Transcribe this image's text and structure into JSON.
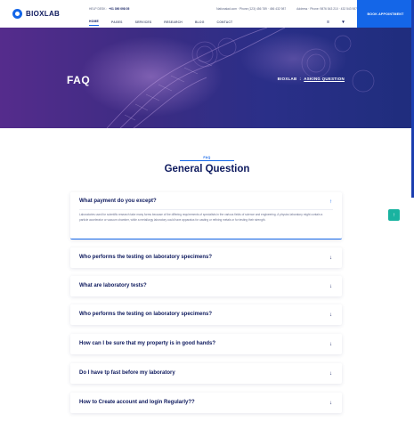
{
  "logo": {
    "text": "BIOXLAB"
  },
  "topbar": {
    "help_label": "HELP DESK :",
    "phone": "+01 390 098 05",
    "info_1": "Nationalad.com  ·  Phone (123) 456 789  ·  456 432 987",
    "info_2": "Address  ·  Phone: 9876 543 210  ·  432 543 987"
  },
  "nav": {
    "items": [
      {
        "label": "HOME",
        "active": true
      },
      {
        "label": "PAGES",
        "active": false
      },
      {
        "label": "SERVICES",
        "active": false
      },
      {
        "label": "RESEARCH",
        "active": false
      },
      {
        "label": "BLOG",
        "active": false
      },
      {
        "label": "CONTACT",
        "active": false
      }
    ],
    "menu_icon": "≡",
    "cart_icon": "▾",
    "appointment_label": "BOOK APPOINTMENT"
  },
  "hero": {
    "title": "FAQ",
    "breadcrumb_home": "BIOXLAB",
    "breadcrumb_sep": ":",
    "breadcrumb_current": "ASKING QUESTION"
  },
  "section": {
    "eyebrow": "FAQ",
    "title": "General Question"
  },
  "faq": [
    {
      "question": "What payment do you except?",
      "open": true,
      "answer": "Laboratories used for scientific research take many forms because of the differing requirements of specialists in the various fields of science and engineering. A physics laboratory might contain a particle accelerator or vacuum chamber, while a metallurgy laboratory could have apparatus for casting or refining metals or for testing their strength."
    },
    {
      "question": "Who performs the testing on laboratory specimens?",
      "open": false
    },
    {
      "question": "What are laboratory tests?",
      "open": false
    },
    {
      "question": "Who performs the testing on laboratory specimens?",
      "open": false
    },
    {
      "question": "How can I be sure that my property is in good hands?",
      "open": false
    },
    {
      "question": "Do I have tp fast before my laboratory",
      "open": false
    },
    {
      "question": "How to Create account and login Regularly??",
      "open": false
    }
  ],
  "icons": {
    "open": "↑",
    "closed": "↓",
    "scroll_top": "↑"
  },
  "colors": {
    "accent": "#1466e8",
    "navy": "#0e1a5e",
    "teal": "#19b3a0"
  }
}
